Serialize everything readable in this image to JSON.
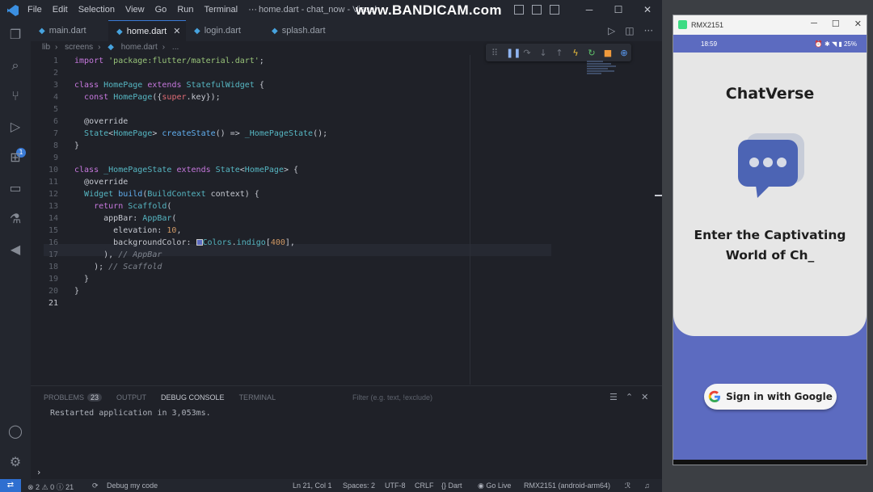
{
  "vscode": {
    "menu": [
      "File",
      "Edit",
      "Selection",
      "View",
      "Go",
      "Run",
      "Terminal",
      "···"
    ],
    "window_title": "home.dart - chat_now - Visual",
    "watermark": "www.BANDICAM.com",
    "tabs": [
      {
        "label": "main.dart",
        "active": false
      },
      {
        "label": "home.dart",
        "active": true
      },
      {
        "label": "login.dart",
        "active": false
      },
      {
        "label": "splash.dart",
        "active": false
      }
    ],
    "breadcrumb": [
      "lib",
      "screens",
      "home.dart",
      "..."
    ],
    "activity_badge": "1",
    "line_numbers": [
      "1",
      "2",
      "3",
      "4",
      "5",
      "6",
      "7",
      "8",
      "9",
      "10",
      "11",
      "12",
      "13",
      "14",
      "15",
      "16",
      "17",
      "18",
      "19",
      "20",
      "21"
    ],
    "panel": {
      "tabs": [
        "PROBLEMS",
        "OUTPUT",
        "DEBUG CONSOLE",
        "TERMINAL"
      ],
      "problems_count": "23",
      "filter_placeholder": "Filter (e.g. text, !exclude)",
      "output_line": "Restarted application in 3,053ms."
    },
    "statusbar": {
      "errors": "2",
      "warnings": "0",
      "infos": "21",
      "debug": "Debug my code",
      "position": "Ln 21, Col 1",
      "spaces": "Spaces: 2",
      "encoding": "UTF-8",
      "eol": "CRLF",
      "language": "Dart",
      "golive": "Go Live",
      "device": "RMX2151 (android-arm64)"
    },
    "colors": {
      "accent": "#3b7bd6",
      "indigo400": "#5c6bc0"
    }
  },
  "emulator": {
    "window_title": "RMX2151",
    "time": "18:59",
    "battery": "25%",
    "app_title": "ChatVerse",
    "tagline": "Enter the Captivating World of Ch_",
    "signin_label": "Sign in with Google",
    "colors": {
      "screen": "#5c6bc0",
      "hero": "#e6e6e6",
      "bubble": "#4c64b4"
    }
  }
}
